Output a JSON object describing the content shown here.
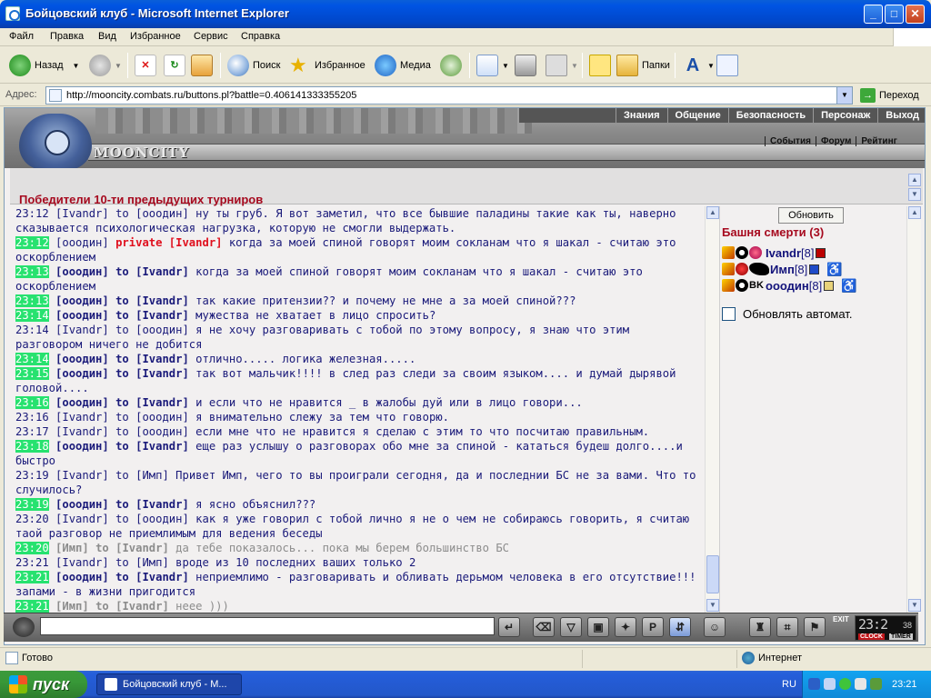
{
  "window": {
    "title": "Бойцовский клуб - Microsoft Internet Explorer",
    "min": "_",
    "max": "□",
    "close": "✕"
  },
  "menu": [
    "Файл",
    "Правка",
    "Вид",
    "Избранное",
    "Сервис",
    "Справка"
  ],
  "toolbar": {
    "back": "Назад",
    "search": "Поиск",
    "favorites": "Избранное",
    "media": "Медиа",
    "folders": "Папки"
  },
  "address": {
    "label": "Адрес:",
    "url": "http://mooncity.combats.ru/buttons.pl?battle=0.406141333355205",
    "go": "Переход"
  },
  "site": {
    "logo": "MOONCITY",
    "topnav": [
      "Знания",
      "Общение",
      "Безопасность",
      "Персонаж",
      "Выход"
    ],
    "subnav": [
      "События",
      "Форум",
      "Рейтинг"
    ],
    "banner": "Победители 10-ти предыдущих турниров"
  },
  "chat": [
    {
      "time": "23:12",
      "hl": false,
      "from": "Ivandr",
      "sep": " to ",
      "to": "ооодин",
      "bold": false,
      "priv": false,
      "gray": false,
      "text": " ну ты груб. Я вот заметил, что все бывшие паладины такие как ты, наверно сказывается психологическая нагрузка, которую не смогли выдержать."
    },
    {
      "time": "23:12",
      "hl": true,
      "from": "ооодин",
      "sep": " ",
      "to": "private [Ivandr]",
      "bold": false,
      "priv": true,
      "gray": false,
      "text": " когда за моей спиной говорят моим сокланам что я шакал - считаю это оскорблением"
    },
    {
      "time": "23:13",
      "hl": true,
      "from": "ооодин",
      "sep": " to ",
      "to": "Ivandr",
      "bold": true,
      "priv": false,
      "gray": false,
      "text": " когда за моей спиной говорят моим сокланам что я шакал - считаю это оскорблением"
    },
    {
      "time": "23:13",
      "hl": true,
      "from": "ооодин",
      "sep": " to ",
      "to": "Ivandr",
      "bold": true,
      "priv": false,
      "gray": false,
      "text": " так какие притензии?? и почему не мне а за моей спиной???"
    },
    {
      "time": "23:14",
      "hl": true,
      "from": "ооодин",
      "sep": " to ",
      "to": "Ivandr",
      "bold": true,
      "priv": false,
      "gray": false,
      "text": " мужества не хватает в лицо спросить?"
    },
    {
      "time": "23:14",
      "hl": false,
      "from": "Ivandr",
      "sep": " to ",
      "to": "ооодин",
      "bold": false,
      "priv": false,
      "gray": false,
      "text": " я не хочу разговаривать с тобой по этому вопросу, я знаю что этим разговором ничего не добится"
    },
    {
      "time": "23:14",
      "hl": true,
      "from": "ооодин",
      "sep": " to ",
      "to": "Ivandr",
      "bold": true,
      "priv": false,
      "gray": false,
      "text": " отлично..... логика железная....."
    },
    {
      "time": "23:15",
      "hl": true,
      "from": "ооодин",
      "sep": " to ",
      "to": "Ivandr",
      "bold": true,
      "priv": false,
      "gray": false,
      "text": " так вот мальчик!!!! в след раз следи за своим языком.... и думай дырявой головой...."
    },
    {
      "time": "23:16",
      "hl": true,
      "from": "ооодин",
      "sep": " to ",
      "to": "Ivandr",
      "bold": true,
      "priv": false,
      "gray": false,
      "text": " и если что не нравится _ в жалобы дуй или в лицо говори..."
    },
    {
      "time": "23:16",
      "hl": false,
      "from": "Ivandr",
      "sep": " to ",
      "to": "ооодин",
      "bold": false,
      "priv": false,
      "gray": false,
      "text": " я внимательно слежу за тем что говорю."
    },
    {
      "time": "23:17",
      "hl": false,
      "from": "Ivandr",
      "sep": " to ",
      "to": "ооодин",
      "bold": false,
      "priv": false,
      "gray": false,
      "text": " если мне что не нравится я сделаю с этим то что посчитаю правильным."
    },
    {
      "time": "23:18",
      "hl": true,
      "from": "ооодин",
      "sep": " to ",
      "to": "Ivandr",
      "bold": true,
      "priv": false,
      "gray": false,
      "text": " еще раз услышу о разговорах обо мне за спиной - кататься будеш долго....и быстро"
    },
    {
      "time": "23:19",
      "hl": false,
      "from": "Ivandr",
      "sep": " to ",
      "to": "Имп",
      "bold": false,
      "priv": false,
      "gray": false,
      "text": " Привет Имп, чего то вы проиграли сегодня, да и последнии БС не за вами. Что то случилось?"
    },
    {
      "time": "23:19",
      "hl": true,
      "from": "ооодин",
      "sep": " to ",
      "to": "Ivandr",
      "bold": true,
      "priv": false,
      "gray": false,
      "text": " я ясно объяснил???"
    },
    {
      "time": "23:20",
      "hl": false,
      "from": "Ivandr",
      "sep": " to ",
      "to": "ооодин",
      "bold": false,
      "priv": false,
      "gray": false,
      "text": " как я уже говорил с тобой лично я не о чем не собираюсь говорить, я считаю таой разговор не приемлимым для ведения беседы"
    },
    {
      "time": "23:20",
      "hl": true,
      "from": "Имп",
      "sep": " to ",
      "to": "Ivandr",
      "bold": true,
      "priv": false,
      "gray": true,
      "text": " да тебе показалось... пока мы берем большинство БС"
    },
    {
      "time": "23:21",
      "hl": false,
      "from": "Ivandr",
      "sep": " to ",
      "to": "Имп",
      "bold": false,
      "priv": false,
      "gray": false,
      "text": " вроде из 10 последних ваших только 2"
    },
    {
      "time": "23:21",
      "hl": true,
      "from": "ооодин",
      "sep": " to ",
      "to": "Ivandr",
      "bold": true,
      "priv": false,
      "gray": false,
      "text": " неприемлимо - разговаривать и обливать дерьмом человека в его отсутствие!!! запами - в жизни пригодится"
    },
    {
      "time": "23:21",
      "hl": true,
      "from": "Имп",
      "sep": " to ",
      "to": "Ivandr",
      "bold": true,
      "priv": false,
      "gray": true,
      "text": " неее )))"
    }
  ],
  "panel": {
    "refresh": "Обновить",
    "room": "Башня смерти (3)",
    "users": [
      {
        "name": "Ivandr",
        "level": "[8]"
      },
      {
        "name": "Имп",
        "level": "[8]"
      },
      {
        "name": "ооодин",
        "level": "[8]"
      }
    ],
    "auto": "Обновлять автомат."
  },
  "clock": {
    "time": "23:2",
    "sec": "38",
    "clock_label": "CLOCK",
    "timer_label": "TIMER",
    "exit": "EXIT"
  },
  "status": {
    "ready": "Готово",
    "zone": "Интернет"
  },
  "taskbar": {
    "start": "пуск",
    "task": "Бойцовский клуб - М...",
    "lang": "RU",
    "time": "23:21"
  },
  "colors": {
    "accent_red": "#a6091e",
    "chat_blue": "#1a1a7a",
    "time_highlight": "#27e26f",
    "private": "#e0101e"
  }
}
